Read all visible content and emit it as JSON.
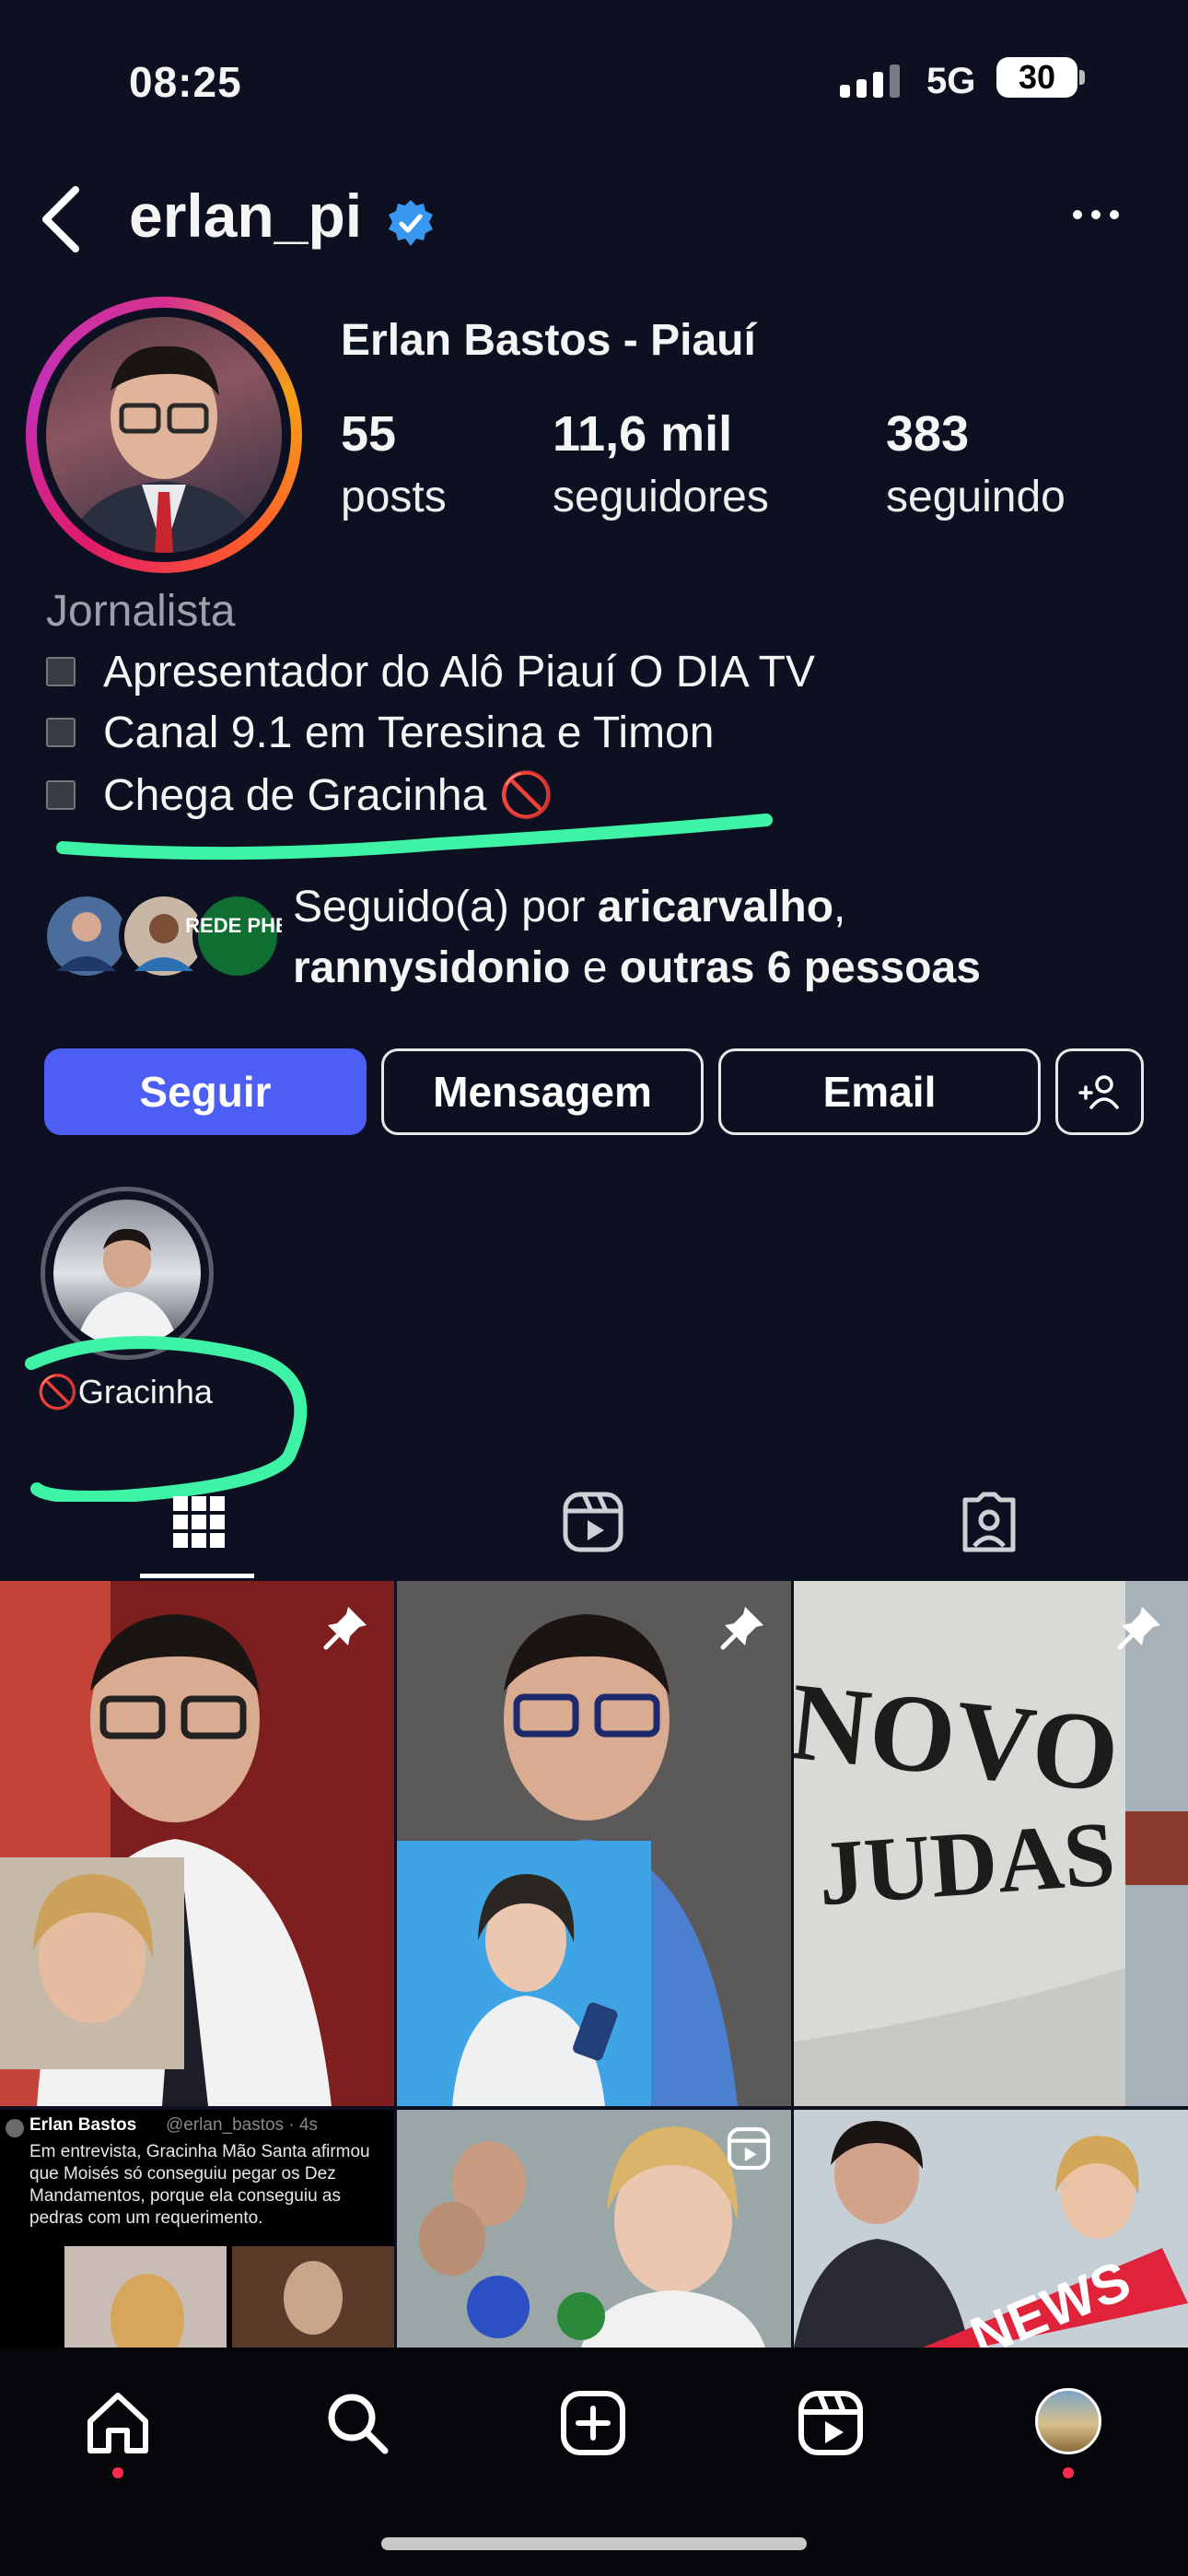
{
  "status_bar": {
    "time": "08:25",
    "network": "5G",
    "battery": "30"
  },
  "header": {
    "username": "erlan_pi"
  },
  "profile": {
    "display_name": "Erlan Bastos - Piauí",
    "stats": [
      {
        "value": "55",
        "label": "posts"
      },
      {
        "value": "11,6 mil",
        "label": "seguidores"
      },
      {
        "value": "383",
        "label": "seguindo"
      }
    ],
    "category": "Jornalista",
    "bio_lines": [
      "Apresentador do Alô Piauí O DIA TV",
      "Canal 9.1 em Teresina e Timon",
      "Chega de Gracinha 🚫"
    ],
    "followed_by": {
      "prefix": "Seguido(a) por ",
      "user1": "aricarvalho",
      "comma": ",",
      "user2": "rannysidonio",
      "and": " e ",
      "others": "outras 6 pessoas",
      "avatar_badge": "REDE PHB"
    }
  },
  "actions": {
    "follow": "Seguir",
    "message": "Mensagem",
    "email": "Email"
  },
  "highlights": [
    {
      "label": "🚫Gracinha"
    }
  ],
  "grid": {
    "post3_text_line1": "NOVO",
    "post3_text_line2": "JUDAS",
    "tweet_author": "Erlan Bastos",
    "tweet_handle": "@erlan_bastos · 4s",
    "tweet_text": "Em entrevista, Gracinha Mão Santa afirmou que Moisés só conseguiu pegar os Dez Mandamentos, porque ela conseguiu as pedras com um requerimento.",
    "news_label": "NEWS"
  },
  "colors": {
    "accent": "#4c5ef4",
    "annotation": "#3ef2a6",
    "verified": "#3897f0"
  }
}
